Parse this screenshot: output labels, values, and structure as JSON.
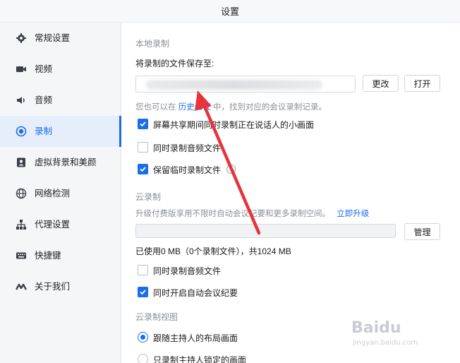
{
  "window": {
    "title": "设置"
  },
  "sidebar": {
    "items": [
      {
        "label": "常规设置",
        "icon": "gear-icon",
        "active": false
      },
      {
        "label": "视频",
        "icon": "video-camera-icon",
        "active": false
      },
      {
        "label": "音频",
        "icon": "speaker-icon",
        "active": false
      },
      {
        "label": "录制",
        "icon": "record-icon",
        "active": true
      },
      {
        "label": "虚拟背景和美颜",
        "icon": "portrait-icon",
        "active": false
      },
      {
        "label": "网络检测",
        "icon": "globe-icon",
        "active": false
      },
      {
        "label": "代理设置",
        "icon": "network-tree-icon",
        "active": false
      },
      {
        "label": "快捷键",
        "icon": "keyboard-icon",
        "active": false
      },
      {
        "label": "关于我们",
        "icon": "brand-logo-icon",
        "active": false
      }
    ]
  },
  "local": {
    "section_title": "本地录制",
    "save_to_label": "将录制的文件保存至:",
    "path_value": "",
    "change_button": "更改",
    "open_button": "打开",
    "hint_prefix": "您也可以在",
    "hint_link": "历史会议",
    "hint_suffix": "中，找到对应的会议录制记录。",
    "options": [
      {
        "label": "屏幕共享期间同时录制正在说话人的小画面",
        "checked": true
      },
      {
        "label": "同时录制音频文件",
        "checked": false
      },
      {
        "label": "保留临时录制文件",
        "checked": true
      }
    ]
  },
  "cloud": {
    "section_title": "云录制",
    "upgrade_text": "升级付费版享用不限时自动会议纪要和更多录制空间。",
    "upgrade_link": "立即升级",
    "storage_used_fraction": 0,
    "manage_button": "管理",
    "usage_text": "已使用0 MB（0个录制文件），共1024 MB",
    "options": [
      {
        "label": "同时录制音频文件",
        "checked": false
      },
      {
        "label": "同时开启自动会议纪要",
        "checked": true
      }
    ]
  },
  "cloud_view": {
    "section_title": "云录制视图",
    "options": [
      {
        "label": "跟随主持人的布局画面",
        "selected": true
      },
      {
        "label": "只录制主持人锁定的画面",
        "selected": false
      }
    ]
  },
  "watermark": {
    "brand": "Baidu",
    "sub": "jingyan.baidu.com"
  },
  "colors": {
    "accent": "#1a6ee8",
    "annotation_arrow": "#e8323c",
    "sidebar_bg": "#f5f6f8"
  }
}
